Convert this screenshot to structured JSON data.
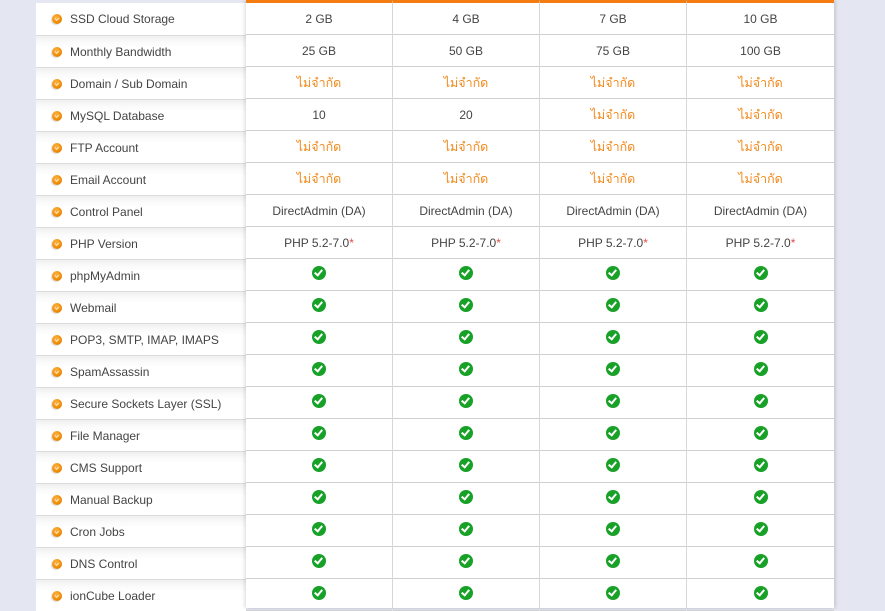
{
  "features": [
    "SSD Cloud Storage",
    "Monthly Bandwidth",
    "Domain / Sub Domain",
    "MySQL Database",
    "FTP Account",
    "Email Account",
    "Control Panel",
    "PHP Version",
    "phpMyAdmin",
    "Webmail",
    "POP3, SMTP, IMAP, IMAPS",
    "SpamAssassin",
    "Secure Sockets Layer (SSL)",
    "File Manager",
    "CMS Support",
    "Manual Backup",
    "Cron Jobs",
    "DNS Control",
    "ionCube Loader"
  ],
  "colors": {
    "accent": "#f47c10",
    "unlimited_text": "#f08a1c",
    "check": "#17a127",
    "background": "#e4e6f2"
  },
  "plans": [
    {
      "values": [
        {
          "type": "text",
          "text": "2 GB"
        },
        {
          "type": "text",
          "text": "25 GB"
        },
        {
          "type": "unlimited",
          "text": "ไม่จำกัด"
        },
        {
          "type": "text",
          "text": "10"
        },
        {
          "type": "unlimited",
          "text": "ไม่จำกัด"
        },
        {
          "type": "unlimited",
          "text": "ไม่จำกัด"
        },
        {
          "type": "text",
          "text": "DirectAdmin (DA)"
        },
        {
          "type": "php",
          "text": "PHP 5.2-7.0",
          "note": "*"
        },
        {
          "type": "check"
        },
        {
          "type": "check"
        },
        {
          "type": "check"
        },
        {
          "type": "check"
        },
        {
          "type": "check"
        },
        {
          "type": "check"
        },
        {
          "type": "check"
        },
        {
          "type": "check"
        },
        {
          "type": "check"
        },
        {
          "type": "check"
        },
        {
          "type": "check"
        }
      ]
    },
    {
      "values": [
        {
          "type": "text",
          "text": "4 GB"
        },
        {
          "type": "text",
          "text": "50 GB"
        },
        {
          "type": "unlimited",
          "text": "ไม่จำกัด"
        },
        {
          "type": "text",
          "text": "20"
        },
        {
          "type": "unlimited",
          "text": "ไม่จำกัด"
        },
        {
          "type": "unlimited",
          "text": "ไม่จำกัด"
        },
        {
          "type": "text",
          "text": "DirectAdmin (DA)"
        },
        {
          "type": "php",
          "text": "PHP 5.2-7.0",
          "note": "*"
        },
        {
          "type": "check"
        },
        {
          "type": "check"
        },
        {
          "type": "check"
        },
        {
          "type": "check"
        },
        {
          "type": "check"
        },
        {
          "type": "check"
        },
        {
          "type": "check"
        },
        {
          "type": "check"
        },
        {
          "type": "check"
        },
        {
          "type": "check"
        },
        {
          "type": "check"
        }
      ]
    },
    {
      "values": [
        {
          "type": "text",
          "text": "7 GB"
        },
        {
          "type": "text",
          "text": "75 GB"
        },
        {
          "type": "unlimited",
          "text": "ไม่จำกัด"
        },
        {
          "type": "unlimited",
          "text": "ไม่จำกัด"
        },
        {
          "type": "unlimited",
          "text": "ไม่จำกัด"
        },
        {
          "type": "unlimited",
          "text": "ไม่จำกัด"
        },
        {
          "type": "text",
          "text": "DirectAdmin (DA)"
        },
        {
          "type": "php",
          "text": "PHP 5.2-7.0",
          "note": "*"
        },
        {
          "type": "check"
        },
        {
          "type": "check"
        },
        {
          "type": "check"
        },
        {
          "type": "check"
        },
        {
          "type": "check"
        },
        {
          "type": "check"
        },
        {
          "type": "check"
        },
        {
          "type": "check"
        },
        {
          "type": "check"
        },
        {
          "type": "check"
        },
        {
          "type": "check"
        }
      ]
    },
    {
      "values": [
        {
          "type": "text",
          "text": "10 GB"
        },
        {
          "type": "text",
          "text": "100 GB"
        },
        {
          "type": "unlimited",
          "text": "ไม่จำกัด"
        },
        {
          "type": "unlimited",
          "text": "ไม่จำกัด"
        },
        {
          "type": "unlimited",
          "text": "ไม่จำกัด"
        },
        {
          "type": "unlimited",
          "text": "ไม่จำกัด"
        },
        {
          "type": "text",
          "text": "DirectAdmin (DA)"
        },
        {
          "type": "php",
          "text": "PHP 5.2-7.0",
          "note": "*"
        },
        {
          "type": "check"
        },
        {
          "type": "check"
        },
        {
          "type": "check"
        },
        {
          "type": "check"
        },
        {
          "type": "check"
        },
        {
          "type": "check"
        },
        {
          "type": "check"
        },
        {
          "type": "check"
        },
        {
          "type": "check"
        },
        {
          "type": "check"
        },
        {
          "type": "check"
        }
      ]
    }
  ]
}
